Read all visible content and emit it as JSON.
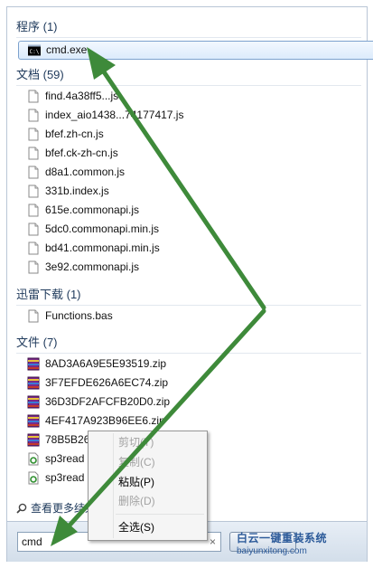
{
  "sections": {
    "programs": {
      "title": "程序 (1)",
      "items": [
        {
          "name": "cmd.exe",
          "icon": "cmd-icon"
        }
      ]
    },
    "documents": {
      "title": "文档 (59)",
      "items": [
        {
          "name": "find.4a38ff5...js",
          "icon": "document-icon"
        },
        {
          "name": "index_aio1438...74177417.js",
          "icon": "document-icon"
        },
        {
          "name": "bfef.zh-cn.js",
          "icon": "document-icon"
        },
        {
          "name": "bfef.ck-zh-cn.js",
          "icon": "document-icon"
        },
        {
          "name": "d8a1.common.js",
          "icon": "document-icon"
        },
        {
          "name": "331b.index.js",
          "icon": "document-icon"
        },
        {
          "name": "615e.commonapi.js",
          "icon": "document-icon"
        },
        {
          "name": "5dc0.commonapi.min.js",
          "icon": "document-icon"
        },
        {
          "name": "bd41.commonapi.min.js",
          "icon": "document-icon"
        },
        {
          "name": "3e92.commonapi.js",
          "icon": "document-icon"
        }
      ]
    },
    "thunder": {
      "title": "迅雷下载 (1)",
      "items": [
        {
          "name": "Functions.bas",
          "icon": "document-icon"
        }
      ]
    },
    "files": {
      "title": "文件 (7)",
      "items": [
        {
          "name": "8AD3A6A9E5E93519.zip",
          "icon": "archive-icon"
        },
        {
          "name": "3F7EFDE626A6EC74.zip",
          "icon": "archive-icon"
        },
        {
          "name": "36D3DF2AFCFB20D0.zip",
          "icon": "archive-icon"
        },
        {
          "name": "4EF417A923B96EE6.zip",
          "icon": "archive-icon"
        },
        {
          "name": "78B5B26",
          "icon": "archive-icon"
        },
        {
          "name": "sp3read",
          "icon": "script-icon"
        },
        {
          "name": "sp3read",
          "icon": "script-icon"
        }
      ]
    }
  },
  "see_more": "查看更多结果",
  "search": {
    "value": "cmd",
    "clear": "×"
  },
  "context_menu": {
    "cut": "剪切(T)",
    "copy": "复制(C)",
    "paste": "粘贴(P)",
    "delete": "删除(D)",
    "select_all": "全选(S)"
  },
  "watermark": {
    "brand": "白云一键重装系统",
    "url": "baiyunxitong.com"
  },
  "colors": {
    "arrow": "#3e8a3a",
    "section_header": "#1e395b",
    "selection_border": "#7da2ce"
  }
}
